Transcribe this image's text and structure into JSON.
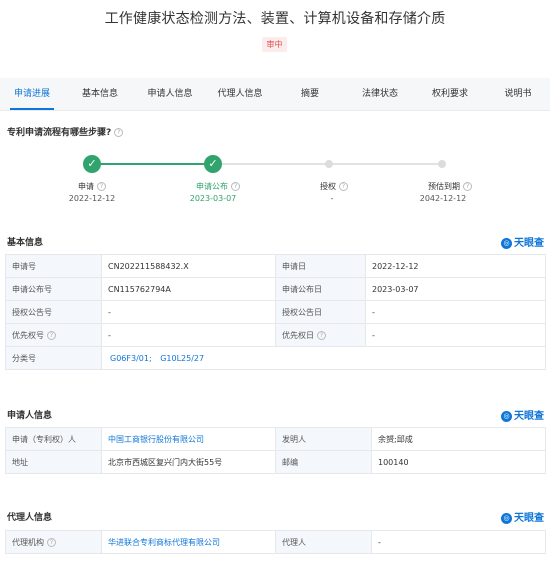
{
  "header": {
    "title": "工作健康状态检测方法、装置、计算机设备和存储介质",
    "status_badge": "审中"
  },
  "tabs": [
    {
      "label": "申请进展",
      "active": true
    },
    {
      "label": "基本信息",
      "active": false
    },
    {
      "label": "申请人信息",
      "active": false
    },
    {
      "label": "代理人信息",
      "active": false
    },
    {
      "label": "摘要",
      "active": false
    },
    {
      "label": "法律状态",
      "active": false
    },
    {
      "label": "权利要求",
      "active": false
    },
    {
      "label": "说明书",
      "active": false
    }
  ],
  "process": {
    "heading": "专利申请流程有哪些步骤?",
    "steps": [
      {
        "label": "申请",
        "date": "2022-12-12",
        "state": "done"
      },
      {
        "label": "申请公布",
        "date": "2023-03-07",
        "state": "current"
      },
      {
        "label": "授权",
        "date": "-",
        "state": "pending"
      },
      {
        "label": "预估到期",
        "date": "2042-12-12",
        "state": "pending"
      }
    ]
  },
  "brand": {
    "name": "天眼查",
    "color": "#0f76d9"
  },
  "basic_info": {
    "heading": "基本信息",
    "rows": [
      {
        "l1": "申请号",
        "v1": "CN202211588432.X",
        "l2": "申请日",
        "v2": "2022-12-12"
      },
      {
        "l1": "申请公布号",
        "v1": "CN115762794A",
        "l2": "申请公布日",
        "v2": "2023-03-07"
      },
      {
        "l1": "授权公告号",
        "v1": "-",
        "l2": "授权公告日",
        "v2": "-"
      },
      {
        "l1": "优先权号",
        "v1": "-",
        "l2": "优先权日",
        "v2": "-"
      }
    ],
    "classification_label": "分类号",
    "classification_codes": [
      "G06F3/01;",
      "G10L25/27"
    ]
  },
  "applicant_info": {
    "heading": "申请人信息",
    "rows": [
      {
        "l1": "申请（专利权）人",
        "v1": "中国工商银行股份有限公司",
        "l2": "发明人",
        "v2": "余赟;邱成"
      },
      {
        "l1": "地址",
        "v1": "北京市西城区复兴门内大街55号",
        "l2": "邮编",
        "v2": "100140"
      }
    ]
  },
  "agent_info": {
    "heading": "代理人信息",
    "rows": [
      {
        "l1": "代理机构",
        "v1": "华进联合专利商标代理有限公司",
        "l2": "代理人",
        "v2": "-"
      }
    ]
  },
  "colors": {
    "accent": "#0f76d9",
    "success": "#30a46c",
    "badge_text": "#e0504f",
    "badge_bg": "#fdecec"
  }
}
